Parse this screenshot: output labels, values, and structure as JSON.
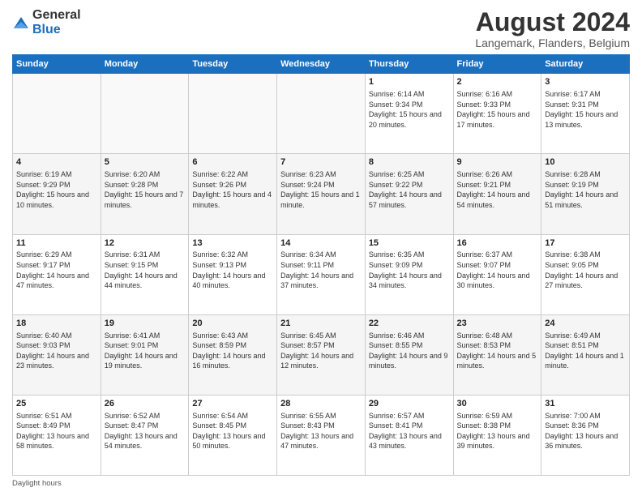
{
  "header": {
    "logo_general": "General",
    "logo_blue": "Blue",
    "main_title": "August 2024",
    "subtitle": "Langemark, Flanders, Belgium"
  },
  "days_of_week": [
    "Sunday",
    "Monday",
    "Tuesday",
    "Wednesday",
    "Thursday",
    "Friday",
    "Saturday"
  ],
  "footer": {
    "note": "Daylight hours"
  },
  "weeks": [
    [
      {
        "day": "",
        "info": ""
      },
      {
        "day": "",
        "info": ""
      },
      {
        "day": "",
        "info": ""
      },
      {
        "day": "",
        "info": ""
      },
      {
        "day": "1",
        "info": "Sunrise: 6:14 AM\nSunset: 9:34 PM\nDaylight: 15 hours and 20 minutes."
      },
      {
        "day": "2",
        "info": "Sunrise: 6:16 AM\nSunset: 9:33 PM\nDaylight: 15 hours and 17 minutes."
      },
      {
        "day": "3",
        "info": "Sunrise: 6:17 AM\nSunset: 9:31 PM\nDaylight: 15 hours and 13 minutes."
      }
    ],
    [
      {
        "day": "4",
        "info": "Sunrise: 6:19 AM\nSunset: 9:29 PM\nDaylight: 15 hours and 10 minutes."
      },
      {
        "day": "5",
        "info": "Sunrise: 6:20 AM\nSunset: 9:28 PM\nDaylight: 15 hours and 7 minutes."
      },
      {
        "day": "6",
        "info": "Sunrise: 6:22 AM\nSunset: 9:26 PM\nDaylight: 15 hours and 4 minutes."
      },
      {
        "day": "7",
        "info": "Sunrise: 6:23 AM\nSunset: 9:24 PM\nDaylight: 15 hours and 1 minute."
      },
      {
        "day": "8",
        "info": "Sunrise: 6:25 AM\nSunset: 9:22 PM\nDaylight: 14 hours and 57 minutes."
      },
      {
        "day": "9",
        "info": "Sunrise: 6:26 AM\nSunset: 9:21 PM\nDaylight: 14 hours and 54 minutes."
      },
      {
        "day": "10",
        "info": "Sunrise: 6:28 AM\nSunset: 9:19 PM\nDaylight: 14 hours and 51 minutes."
      }
    ],
    [
      {
        "day": "11",
        "info": "Sunrise: 6:29 AM\nSunset: 9:17 PM\nDaylight: 14 hours and 47 minutes."
      },
      {
        "day": "12",
        "info": "Sunrise: 6:31 AM\nSunset: 9:15 PM\nDaylight: 14 hours and 44 minutes."
      },
      {
        "day": "13",
        "info": "Sunrise: 6:32 AM\nSunset: 9:13 PM\nDaylight: 14 hours and 40 minutes."
      },
      {
        "day": "14",
        "info": "Sunrise: 6:34 AM\nSunset: 9:11 PM\nDaylight: 14 hours and 37 minutes."
      },
      {
        "day": "15",
        "info": "Sunrise: 6:35 AM\nSunset: 9:09 PM\nDaylight: 14 hours and 34 minutes."
      },
      {
        "day": "16",
        "info": "Sunrise: 6:37 AM\nSunset: 9:07 PM\nDaylight: 14 hours and 30 minutes."
      },
      {
        "day": "17",
        "info": "Sunrise: 6:38 AM\nSunset: 9:05 PM\nDaylight: 14 hours and 27 minutes."
      }
    ],
    [
      {
        "day": "18",
        "info": "Sunrise: 6:40 AM\nSunset: 9:03 PM\nDaylight: 14 hours and 23 minutes."
      },
      {
        "day": "19",
        "info": "Sunrise: 6:41 AM\nSunset: 9:01 PM\nDaylight: 14 hours and 19 minutes."
      },
      {
        "day": "20",
        "info": "Sunrise: 6:43 AM\nSunset: 8:59 PM\nDaylight: 14 hours and 16 minutes."
      },
      {
        "day": "21",
        "info": "Sunrise: 6:45 AM\nSunset: 8:57 PM\nDaylight: 14 hours and 12 minutes."
      },
      {
        "day": "22",
        "info": "Sunrise: 6:46 AM\nSunset: 8:55 PM\nDaylight: 14 hours and 9 minutes."
      },
      {
        "day": "23",
        "info": "Sunrise: 6:48 AM\nSunset: 8:53 PM\nDaylight: 14 hours and 5 minutes."
      },
      {
        "day": "24",
        "info": "Sunrise: 6:49 AM\nSunset: 8:51 PM\nDaylight: 14 hours and 1 minute."
      }
    ],
    [
      {
        "day": "25",
        "info": "Sunrise: 6:51 AM\nSunset: 8:49 PM\nDaylight: 13 hours and 58 minutes."
      },
      {
        "day": "26",
        "info": "Sunrise: 6:52 AM\nSunset: 8:47 PM\nDaylight: 13 hours and 54 minutes."
      },
      {
        "day": "27",
        "info": "Sunrise: 6:54 AM\nSunset: 8:45 PM\nDaylight: 13 hours and 50 minutes."
      },
      {
        "day": "28",
        "info": "Sunrise: 6:55 AM\nSunset: 8:43 PM\nDaylight: 13 hours and 47 minutes."
      },
      {
        "day": "29",
        "info": "Sunrise: 6:57 AM\nSunset: 8:41 PM\nDaylight: 13 hours and 43 minutes."
      },
      {
        "day": "30",
        "info": "Sunrise: 6:59 AM\nSunset: 8:38 PM\nDaylight: 13 hours and 39 minutes."
      },
      {
        "day": "31",
        "info": "Sunrise: 7:00 AM\nSunset: 8:36 PM\nDaylight: 13 hours and 36 minutes."
      }
    ]
  ]
}
